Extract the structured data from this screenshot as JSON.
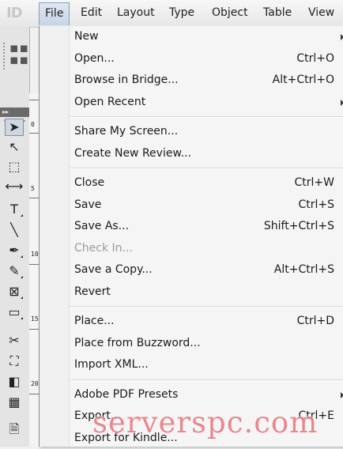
{
  "app": {
    "logo": "ID"
  },
  "menubar": {
    "items": [
      "File",
      "Edit",
      "Layout",
      "Type",
      "Object",
      "Table",
      "View"
    ],
    "active": "File"
  },
  "file_menu": {
    "groups": [
      [
        {
          "label": "New",
          "shortcut": "",
          "submenu": true,
          "enabled": true
        },
        {
          "label": "Open...",
          "shortcut": "Ctrl+O",
          "submenu": false,
          "enabled": true
        },
        {
          "label": "Browse in Bridge...",
          "shortcut": "Alt+Ctrl+O",
          "submenu": false,
          "enabled": true
        },
        {
          "label": "Open Recent",
          "shortcut": "",
          "submenu": true,
          "enabled": true
        }
      ],
      [
        {
          "label": "Share My Screen...",
          "shortcut": "",
          "submenu": false,
          "enabled": true
        },
        {
          "label": "Create New Review...",
          "shortcut": "",
          "submenu": false,
          "enabled": true
        }
      ],
      [
        {
          "label": "Close",
          "shortcut": "Ctrl+W",
          "submenu": false,
          "enabled": true
        },
        {
          "label": "Save",
          "shortcut": "Ctrl+S",
          "submenu": false,
          "enabled": true
        },
        {
          "label": "Save As...",
          "shortcut": "Shift+Ctrl+S",
          "submenu": false,
          "enabled": true
        },
        {
          "label": "Check In...",
          "shortcut": "",
          "submenu": false,
          "enabled": false
        },
        {
          "label": "Save a Copy...",
          "shortcut": "Alt+Ctrl+S",
          "submenu": false,
          "enabled": true
        },
        {
          "label": "Revert",
          "shortcut": "",
          "submenu": false,
          "enabled": true
        }
      ],
      [
        {
          "label": "Place...",
          "shortcut": "Ctrl+D",
          "submenu": false,
          "enabled": true
        },
        {
          "label": "Place from Buzzword...",
          "shortcut": "",
          "submenu": false,
          "enabled": true
        },
        {
          "label": "Import XML...",
          "shortcut": "",
          "submenu": false,
          "enabled": true
        }
      ],
      [
        {
          "label": "Adobe PDF Presets",
          "shortcut": "",
          "submenu": true,
          "enabled": true
        },
        {
          "label": "Export...",
          "shortcut": "Ctrl+E",
          "submenu": false,
          "enabled": true
        },
        {
          "label": "Export for Kindle...",
          "shortcut": "",
          "submenu": false,
          "enabled": true
        }
      ]
    ]
  },
  "ruler": {
    "labels": [
      "0",
      "5",
      "10",
      "15",
      "20"
    ]
  },
  "tools": [
    {
      "name": "selection-tool",
      "glyph": "➤",
      "selected": true
    },
    {
      "name": "direct-selection-tool",
      "glyph": "↖",
      "selected": false
    },
    {
      "name": "page-tool",
      "glyph": "⬚",
      "selected": false
    },
    {
      "name": "gap-tool",
      "glyph": "⟷",
      "selected": false
    },
    {
      "name": "type-tool",
      "glyph": "T",
      "selected": false
    },
    {
      "name": "line-tool",
      "glyph": "╲",
      "selected": false
    },
    {
      "name": "pen-tool",
      "glyph": "✒",
      "selected": false
    },
    {
      "name": "pencil-tool",
      "glyph": "✎",
      "selected": false
    },
    {
      "name": "rectangle-frame-tool",
      "glyph": "⊠",
      "selected": false
    },
    {
      "name": "rectangle-tool",
      "glyph": "▭",
      "selected": false
    },
    {
      "name": "scissors-tool",
      "glyph": "✂",
      "selected": false
    },
    {
      "name": "free-transform-tool",
      "glyph": "⛶",
      "selected": false
    },
    {
      "name": "gradient-swatch-tool",
      "glyph": "◧",
      "selected": false
    },
    {
      "name": "gradient-feather-tool",
      "glyph": "▦",
      "selected": false
    },
    {
      "name": "note-tool",
      "glyph": "🗎",
      "selected": false
    }
  ],
  "colors": {
    "menu_highlight": "#c7d5e8",
    "disabled_text": "#9a9a9a"
  },
  "watermark": "serverspc.com"
}
